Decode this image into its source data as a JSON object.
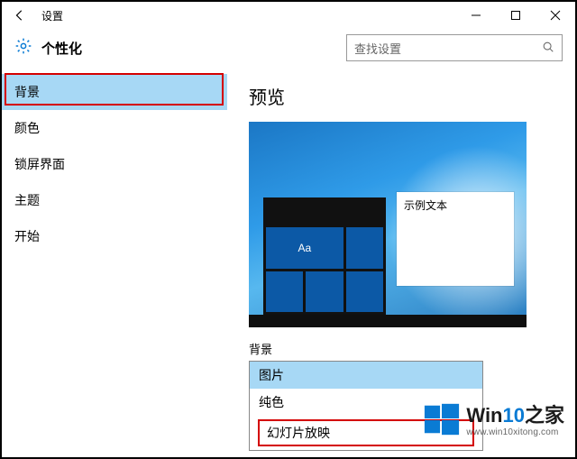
{
  "window": {
    "title": "设置"
  },
  "header": {
    "page_title": "个性化"
  },
  "search": {
    "placeholder": "查找设置"
  },
  "sidebar": {
    "items": [
      {
        "label": "背景",
        "selected": true
      },
      {
        "label": "颜色"
      },
      {
        "label": "锁屏界面"
      },
      {
        "label": "主题"
      },
      {
        "label": "开始"
      }
    ]
  },
  "main": {
    "preview_title": "预览",
    "sample_window_text": "示例文本",
    "tile_text": "Aa",
    "bg_label": "背景",
    "dropdown": {
      "options": [
        {
          "label": "图片",
          "selected": true
        },
        {
          "label": "纯色"
        },
        {
          "label": "幻灯片放映",
          "highlighted": true
        }
      ]
    }
  },
  "watermark": {
    "text_prefix": "Win",
    "text_num": "10",
    "text_suffix": "之家",
    "url": "www.win10xitong.com"
  }
}
